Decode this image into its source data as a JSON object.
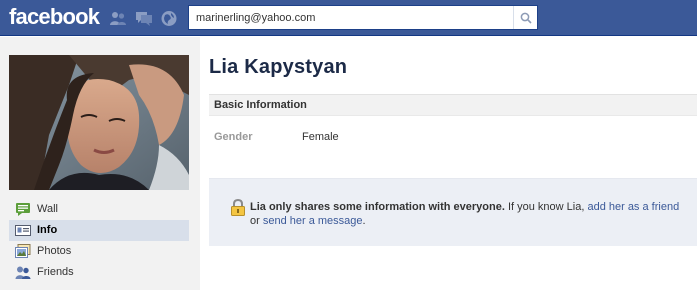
{
  "header": {
    "logo_text": "facebook",
    "search": {
      "value": "marinerling@yahoo.com",
      "placeholder": ""
    },
    "jewels": [
      "friend-requests-icon",
      "messages-icon",
      "notifications-icon"
    ]
  },
  "colors": {
    "brand_blue": "#3b5998",
    "nav_active_bg": "#d8dfea",
    "notice_bg": "#eceff5",
    "link": "#3b5998"
  },
  "sidebar": {
    "items": [
      {
        "label": "Wall",
        "icon": "wall-icon",
        "active": false
      },
      {
        "label": "Info",
        "icon": "info-icon",
        "active": true
      },
      {
        "label": "Photos",
        "icon": "photos-icon",
        "active": false
      },
      {
        "label": "Friends",
        "icon": "friends-icon",
        "active": false
      }
    ]
  },
  "profile": {
    "name": "Lia Kapystyan",
    "basic_info": {
      "title": "Basic Information",
      "fields": [
        {
          "label": "Gender",
          "value": "Female"
        }
      ]
    },
    "privacy_notice": {
      "bold": "Lia only shares some information with everyone.",
      "text1": " If you know Lia, ",
      "link1": "add her as a friend",
      "text2": " or ",
      "link2": "send her a message",
      "text3": "."
    }
  }
}
